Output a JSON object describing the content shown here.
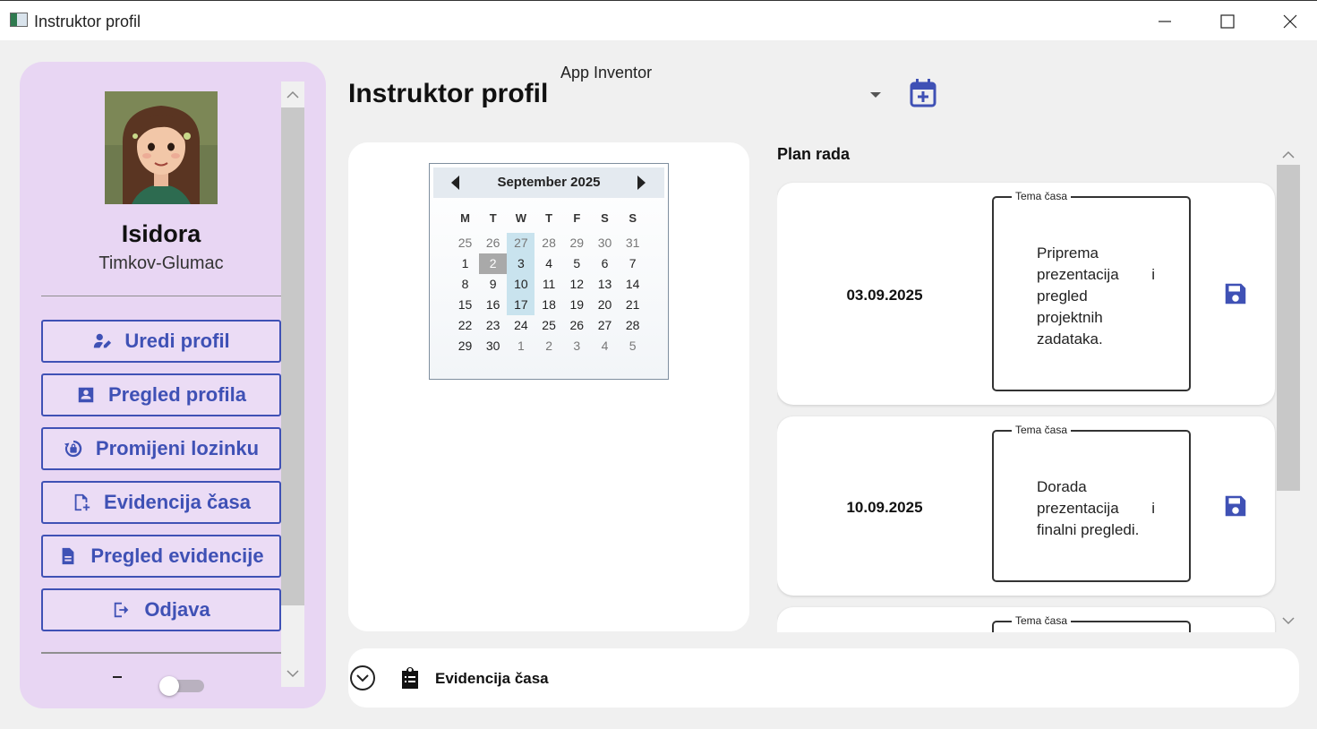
{
  "window": {
    "title": "Instruktor profil"
  },
  "sidebar": {
    "first_name": "Isidora",
    "last_name": "Timkov-Glumac",
    "buttons": [
      {
        "label": "Uredi profil",
        "icon": "user-edit-icon"
      },
      {
        "label": "Pregled profila",
        "icon": "id-card-icon"
      },
      {
        "label": "Promijeni lozinku",
        "icon": "lock-reset-icon"
      },
      {
        "label": "Evidencija časa",
        "icon": "file-add-icon"
      },
      {
        "label": "Pregled evidencije",
        "icon": "document-icon"
      },
      {
        "label": "Odjava",
        "icon": "logout-icon"
      }
    ],
    "toggle_on": false
  },
  "header": {
    "title": "Instruktor profil",
    "course_selected": "App Inventor",
    "add_button_icon": "calendar-plus-icon"
  },
  "calendar": {
    "month_label": "September 2025",
    "weekdays": [
      "M",
      "T",
      "W",
      "T",
      "F",
      "S",
      "S"
    ],
    "weeks": [
      [
        "25",
        "26",
        "27",
        "28",
        "29",
        "30",
        "31"
      ],
      [
        "1",
        "2",
        "3",
        "4",
        "5",
        "6",
        "7"
      ],
      [
        "8",
        "9",
        "10",
        "11",
        "12",
        "13",
        "14"
      ],
      [
        "15",
        "16",
        "17",
        "18",
        "19",
        "20",
        "21"
      ],
      [
        "22",
        "23",
        "24",
        "25",
        "26",
        "27",
        "28"
      ],
      [
        "29",
        "30",
        "1",
        "2",
        "3",
        "4",
        "5"
      ]
    ],
    "other_month_cells": [
      [
        0,
        0
      ],
      [
        0,
        1
      ],
      [
        0,
        2
      ],
      [
        0,
        3
      ],
      [
        0,
        4
      ],
      [
        0,
        5
      ],
      [
        0,
        6
      ],
      [
        5,
        2
      ],
      [
        5,
        3
      ],
      [
        5,
        4
      ],
      [
        5,
        5
      ],
      [
        5,
        6
      ]
    ],
    "highlighted_cells": [
      [
        0,
        2
      ],
      [
        1,
        2
      ],
      [
        2,
        2
      ],
      [
        3,
        2
      ]
    ],
    "today_cell": [
      1,
      1
    ]
  },
  "plan": {
    "title": "Plan rada",
    "topic_legend": "Tema časa",
    "entries": [
      {
        "date": "03.09.2025",
        "topic": "Priprema prezentacija i pregled projektnih zadataka."
      },
      {
        "date": "10.09.2025",
        "topic": "Dorada prezentacija i finalni pregledi."
      },
      {
        "date": "",
        "topic": ""
      }
    ]
  },
  "footer": {
    "label": "Evidencija časa",
    "icon": "clipboard-icon"
  },
  "colors": {
    "accent": "#3f51b5",
    "sidebar_bg": "#e8d6f3",
    "calendar_highlight": "#c9e3ee"
  }
}
